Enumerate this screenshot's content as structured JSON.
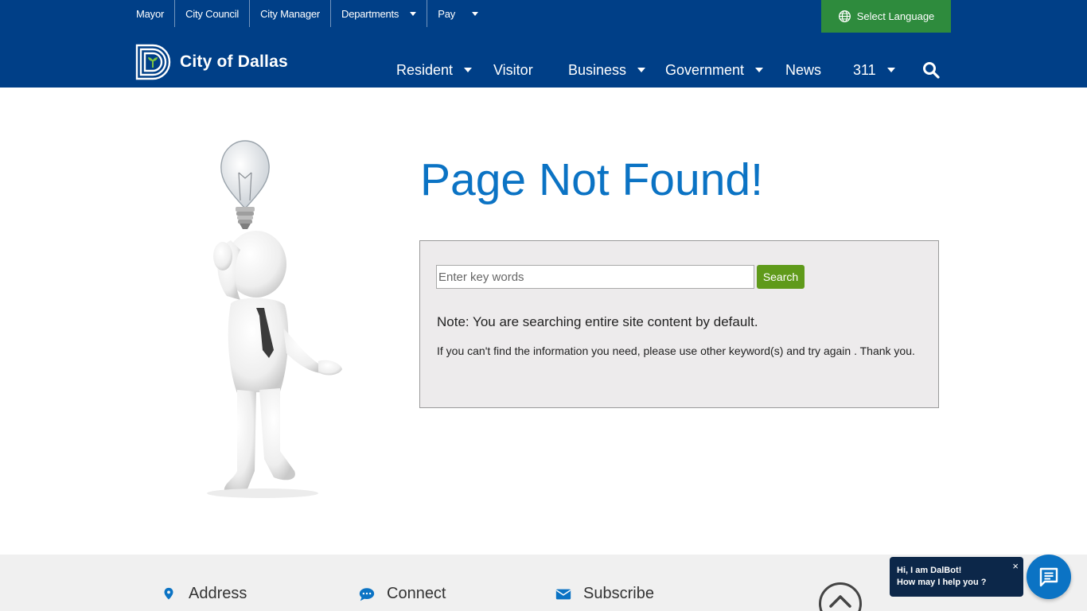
{
  "header": {
    "utility_nav": [
      "Mayor",
      "City Council",
      "City Manager",
      "Departments",
      "Pay"
    ],
    "language_button": "Select Language",
    "logo_text": "City of Dallas",
    "main_nav": [
      "Resident",
      "Visitor",
      "Business",
      "Government",
      "News",
      "311"
    ],
    "colors": {
      "header_bg": "#003f87",
      "language_bg": "#2e8b3d"
    }
  },
  "main": {
    "title": "Page Not Found!",
    "search": {
      "placeholder": "Enter key words",
      "button": "Search"
    },
    "note": "Note: You are searching entire site content by default.",
    "help_text": "If you can't find the information you need, please use other keyword(s) and try again . Thank you.",
    "colors": {
      "title": "#0b73c4",
      "search_button": "#5f9a1a"
    }
  },
  "footer": {
    "columns": [
      {
        "label": "Address",
        "icon": "map-marker-icon"
      },
      {
        "label": "Connect",
        "icon": "chat-icon"
      },
      {
        "label": "Subscribe",
        "icon": "envelope-icon"
      }
    ]
  },
  "chatbot": {
    "line1": "Hi, I am DalBot!",
    "line2": "How may I help you ?",
    "close": "×"
  }
}
